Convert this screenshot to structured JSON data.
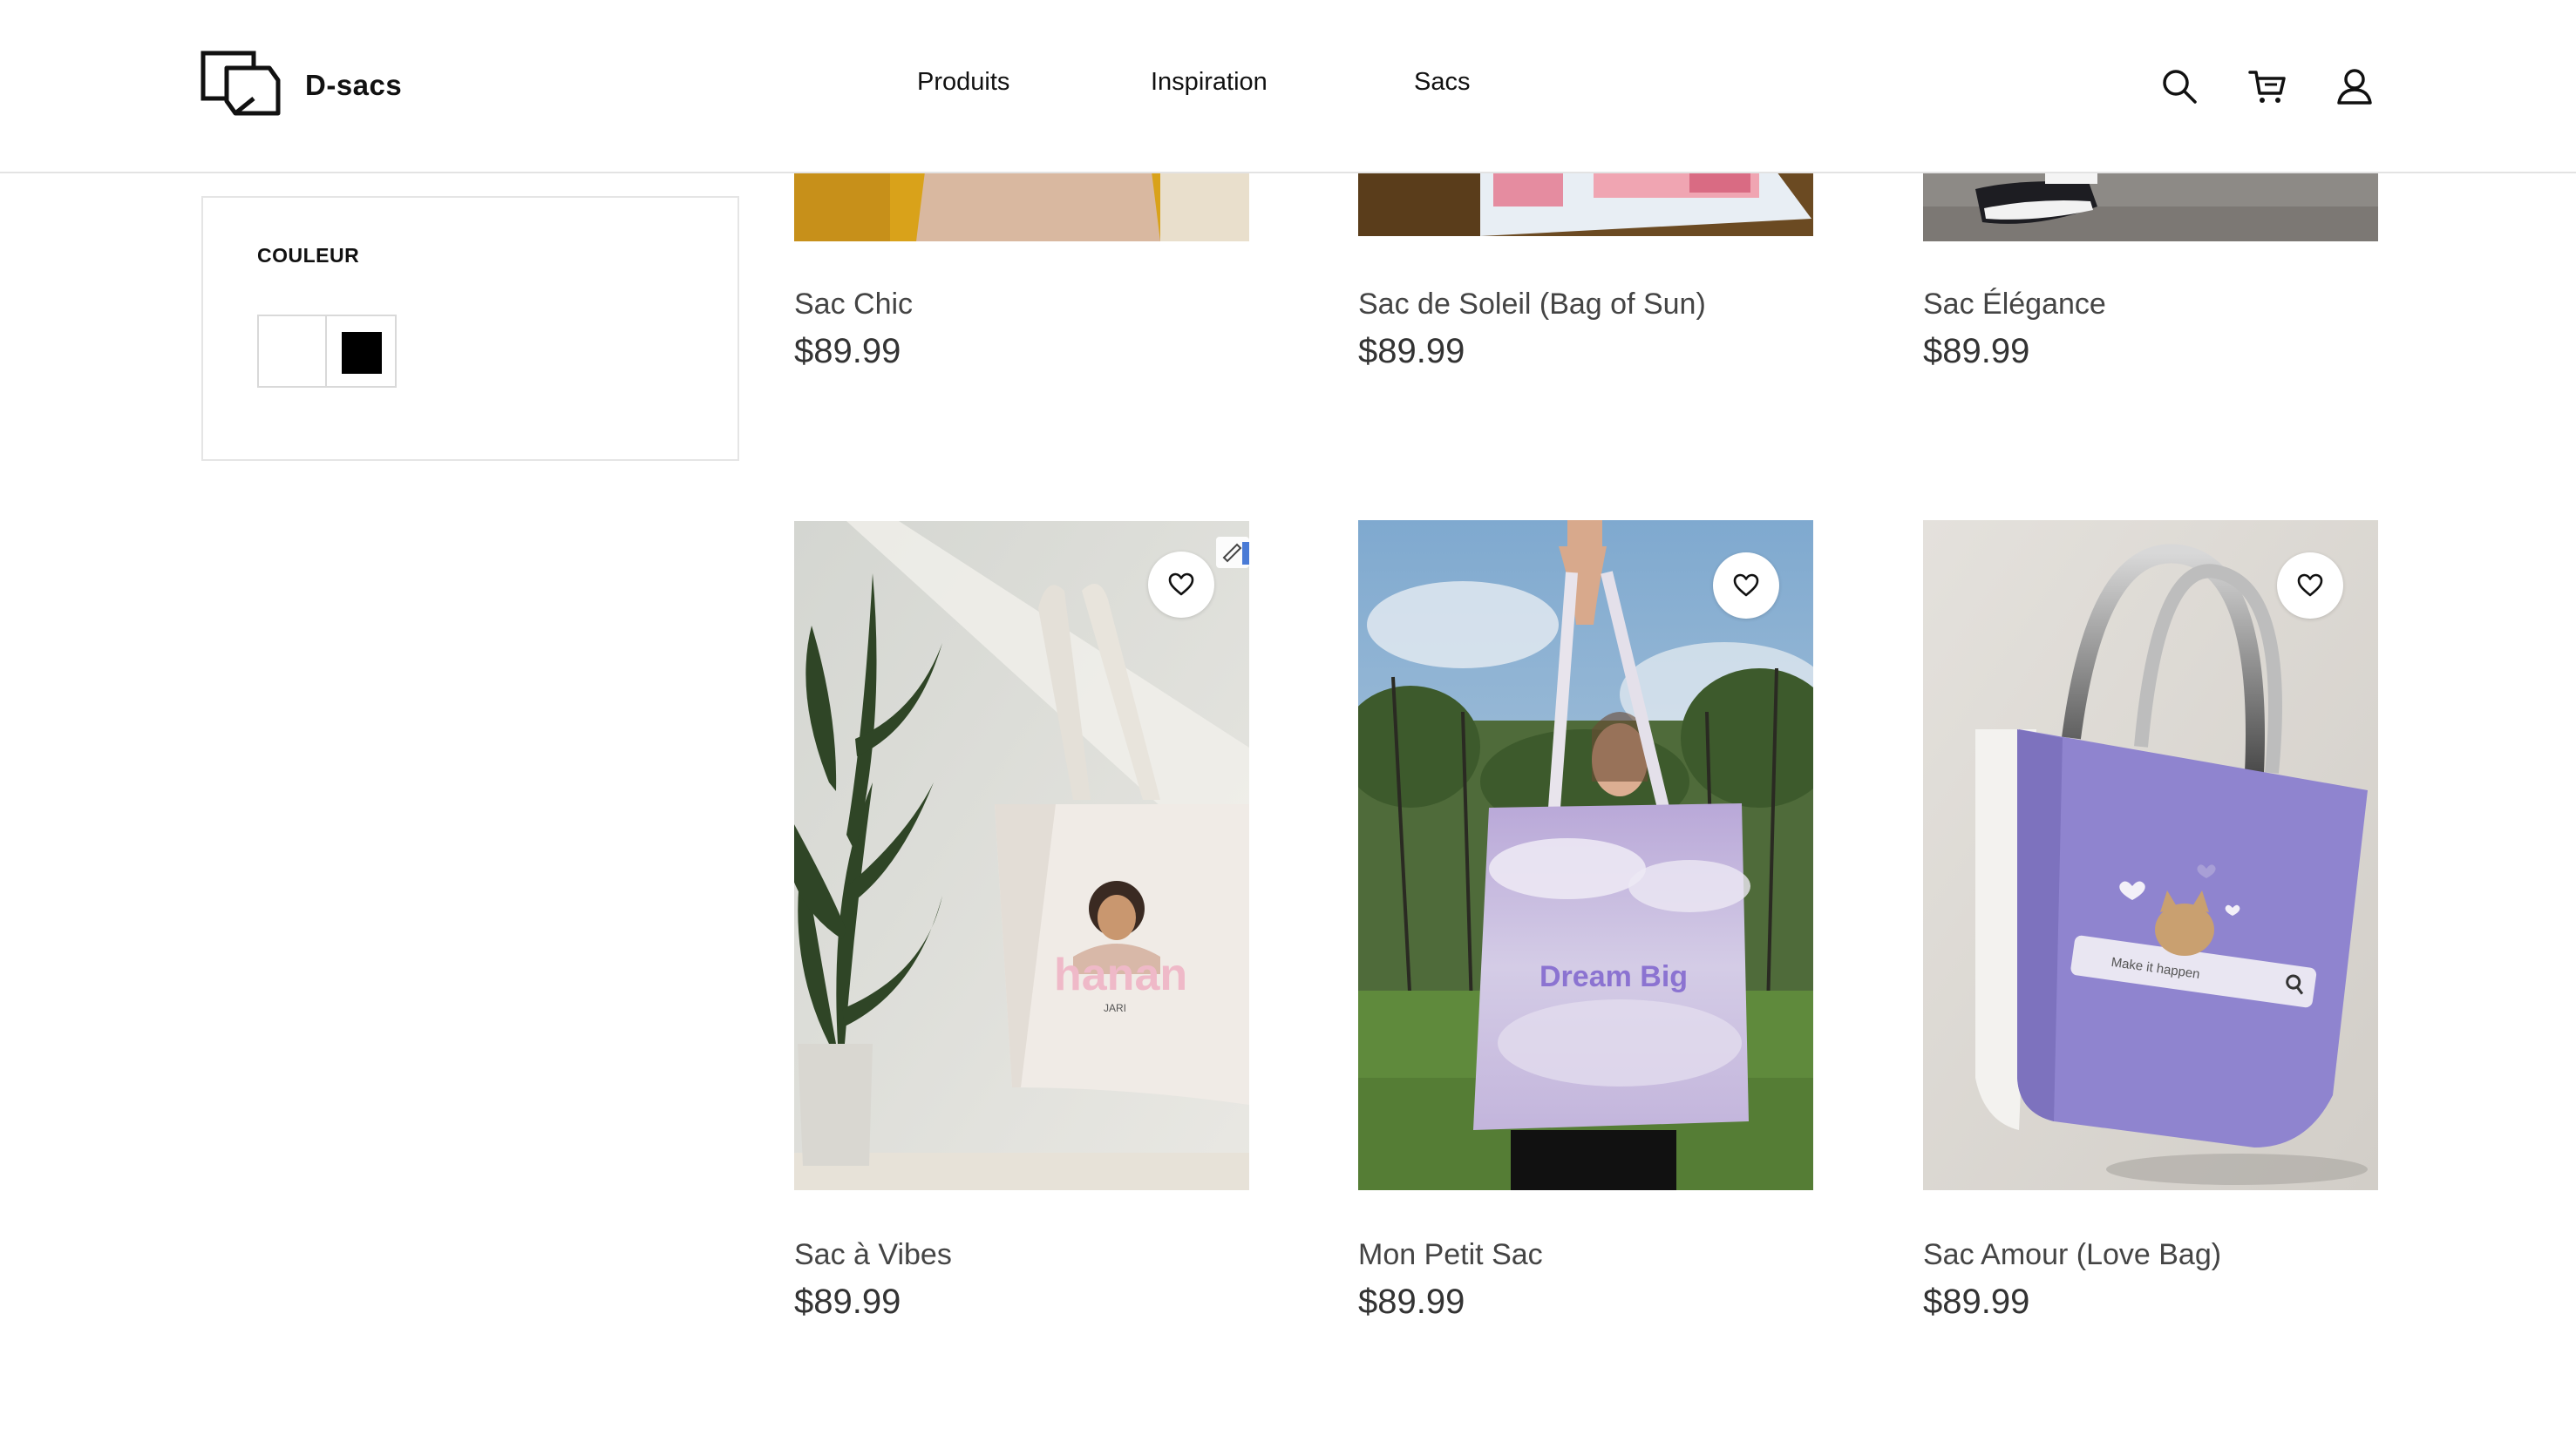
{
  "brand": {
    "name": "D-sacs",
    "logo_icon": "overlapping-squares-logo"
  },
  "nav": {
    "items": [
      {
        "label": "Produits"
      },
      {
        "label": "Inspiration"
      },
      {
        "label": "Sacs"
      }
    ]
  },
  "header_icons": [
    "search-icon",
    "cart-icon",
    "user-icon"
  ],
  "filter": {
    "title": "COULEUR",
    "colors": [
      {
        "name": "white",
        "hex": "#ffffff"
      },
      {
        "name": "black",
        "hex": "#000000"
      }
    ]
  },
  "products": [
    {
      "name": "Sac Chic",
      "price": "$89.99"
    },
    {
      "name": "Sac de Soleil (Bag of Sun)",
      "price": "$89.99"
    },
    {
      "name": "Sac Élégance",
      "price": "$89.99"
    },
    {
      "name": "Sac à Vibes",
      "price": "$89.99"
    },
    {
      "name": "Mon Petit Sac",
      "price": "$89.99"
    },
    {
      "name": "Sac Amour (Love Bag)",
      "price": "$89.99"
    }
  ],
  "product_images": {
    "bag_text_vibes": "hanan",
    "bag_subtext_vibes": "JARI",
    "bag_text_petit": "Dream Big",
    "bag_text_amour": "Make it happen"
  }
}
